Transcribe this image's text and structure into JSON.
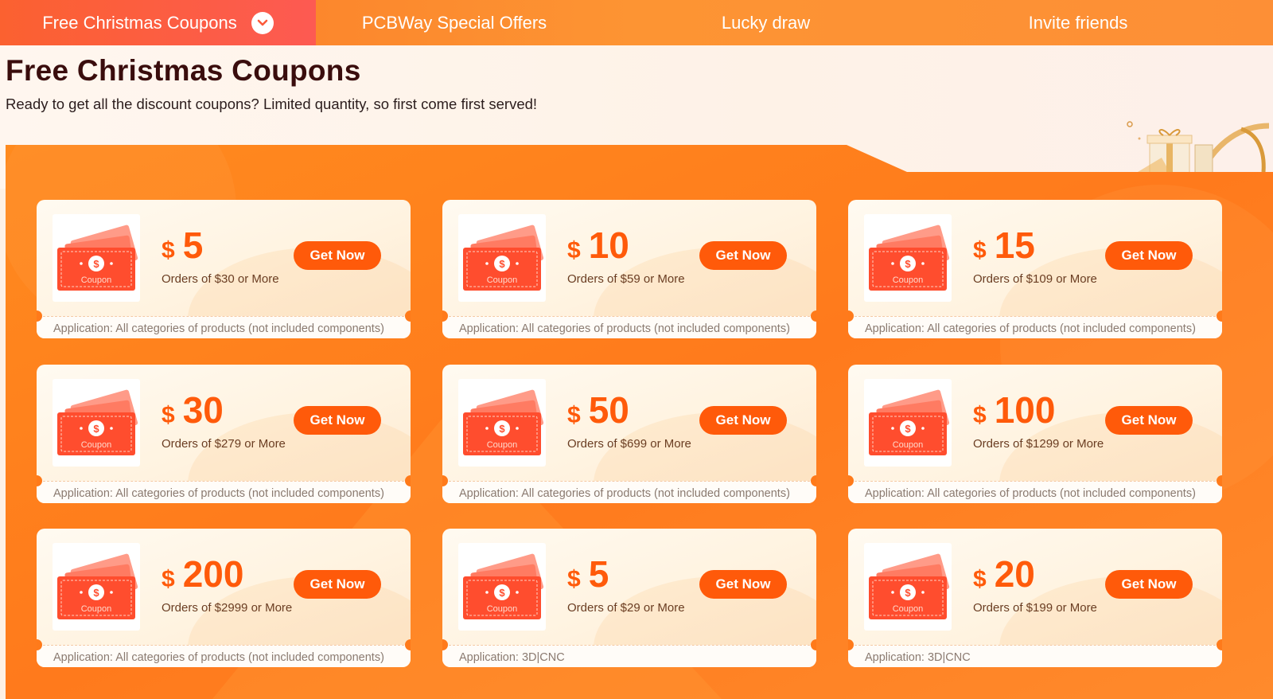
{
  "nav": {
    "tabs": [
      {
        "label": "Free Christmas Coupons",
        "active": true
      },
      {
        "label": "PCBWay Special Offers",
        "active": false
      },
      {
        "label": "Lucky draw",
        "active": false
      },
      {
        "label": "Invite friends",
        "active": false
      }
    ]
  },
  "header": {
    "title": "Free Christmas Coupons",
    "subtitle": "Ready to get all the discount coupons? Limited quantity, so first come first served!"
  },
  "coupon_image_label": "Coupon",
  "coupons": [
    {
      "currency": "$",
      "amount": "5",
      "condition": "Orders of $30 or More",
      "button": "Get Now",
      "application": "Application: All categories of products (not included components)"
    },
    {
      "currency": "$",
      "amount": "10",
      "condition": "Orders of $59 or More",
      "button": "Get Now",
      "application": "Application: All categories of products (not included components)"
    },
    {
      "currency": "$",
      "amount": "15",
      "condition": "Orders of $109 or More",
      "button": "Get Now",
      "application": "Application: All categories of products (not included components)"
    },
    {
      "currency": "$",
      "amount": "30",
      "condition": "Orders of $279 or More",
      "button": "Get Now",
      "application": "Application: All categories of products (not included components)"
    },
    {
      "currency": "$",
      "amount": "50",
      "condition": "Orders of $699 or More",
      "button": "Get Now",
      "application": "Application: All categories of products (not included components)"
    },
    {
      "currency": "$",
      "amount": "100",
      "condition": "Orders of $1299 or More",
      "button": "Get Now",
      "application": "Application: All categories of products (not included components)"
    },
    {
      "currency": "$",
      "amount": "200",
      "condition": "Orders of $2999 or More",
      "button": "Get Now",
      "application": "Application: All categories of products (not included components)"
    },
    {
      "currency": "$",
      "amount": "5",
      "condition": "Orders of $29 or More",
      "button": "Get Now",
      "application": "Application: 3D|CNC"
    },
    {
      "currency": "$",
      "amount": "20",
      "condition": "Orders of $199 or More",
      "button": "Get Now",
      "application": "Application: 3D|CNC"
    }
  ],
  "colors": {
    "accent": "#ff5a0a",
    "panel": "#ff7a1a",
    "title": "#3a0d0d"
  },
  "icons": {
    "tab_dropdown": "chevron-down-icon",
    "coupon": "coupon-ticket-icon",
    "decoration": "gift-box-icon"
  }
}
